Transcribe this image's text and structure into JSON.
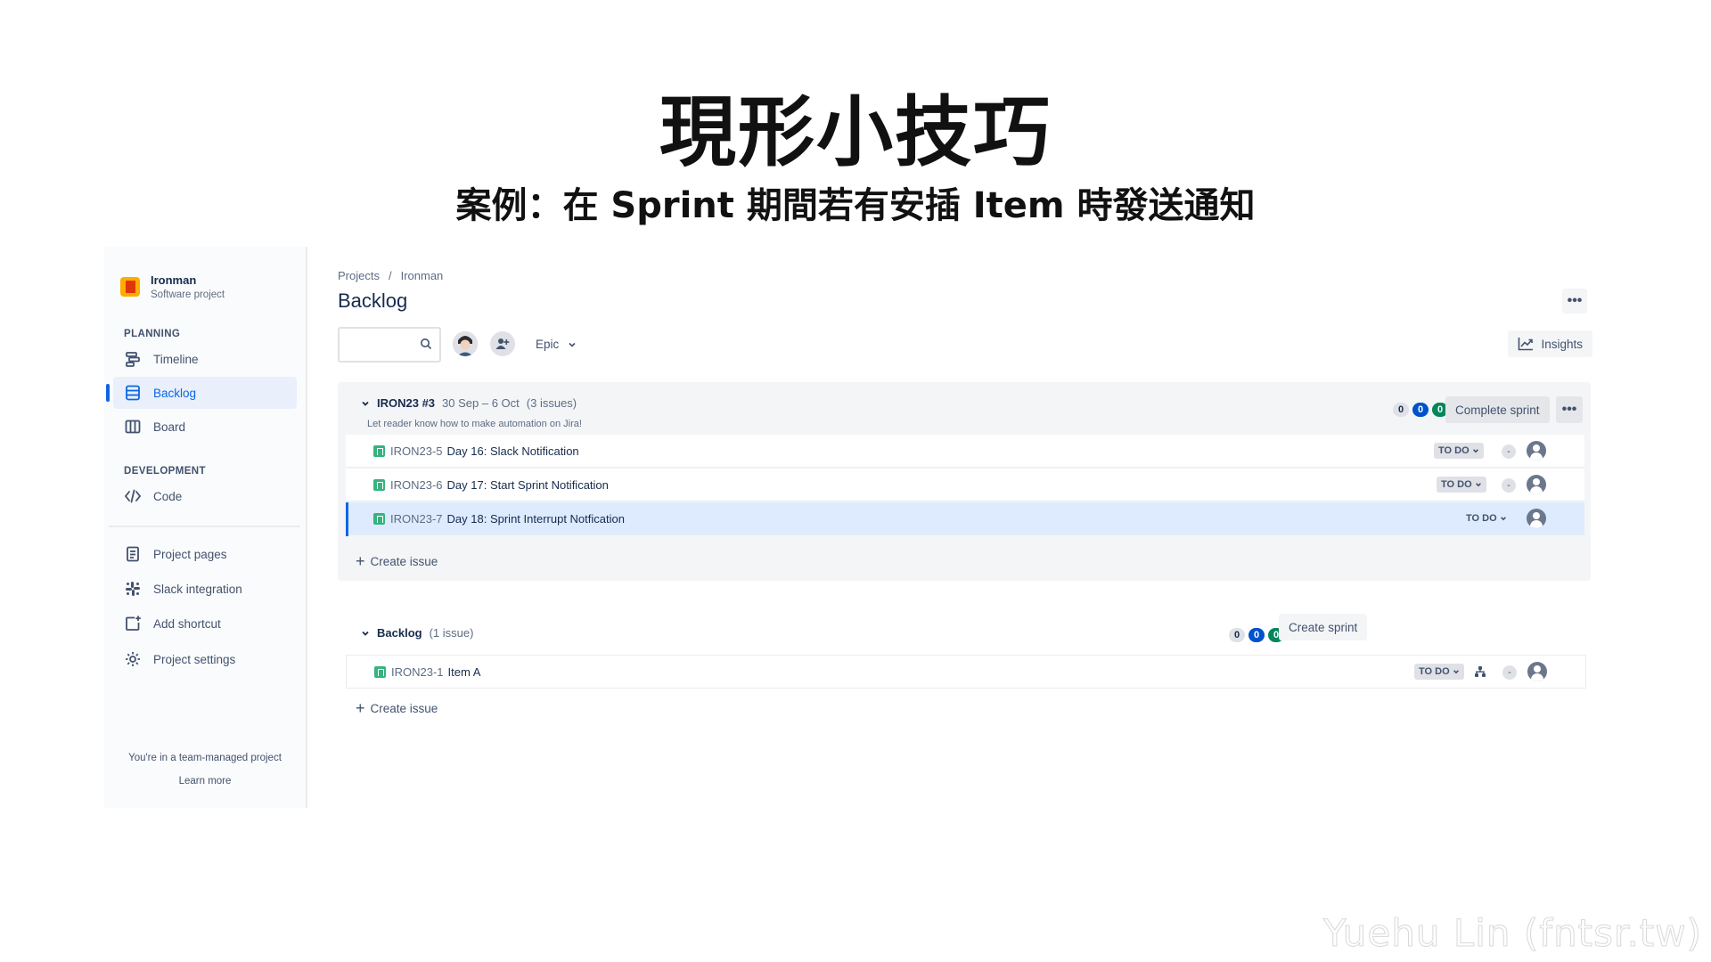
{
  "slide": {
    "title": "現形小技巧",
    "subtitle": "案例：在 Sprint 期間若有安插 Item 時發送通知",
    "watermark": "Yuehu Lin (fntsr.tw)"
  },
  "sidebar": {
    "project_name": "Ironman",
    "project_type": "Software project",
    "planning_label": "PLANNING",
    "development_label": "DEVELOPMENT",
    "items": [
      {
        "label": "Timeline",
        "icon": "timeline-icon"
      },
      {
        "label": "Backlog",
        "icon": "backlog-icon",
        "active": true
      },
      {
        "label": "Board",
        "icon": "board-icon"
      },
      {
        "label": "Code",
        "icon": "code-icon"
      },
      {
        "label": "Project pages",
        "icon": "pages-icon"
      },
      {
        "label": "Slack integration",
        "icon": "slack-icon"
      },
      {
        "label": "Add shortcut",
        "icon": "add-shortcut-icon"
      },
      {
        "label": "Project settings",
        "icon": "settings-icon"
      }
    ],
    "footer_text": "You're in a team-managed project",
    "footer_link": "Learn more"
  },
  "header": {
    "breadcrumb": [
      "Projects",
      "Ironman"
    ],
    "breadcrumb_sep": "/",
    "title": "Backlog",
    "more": "•••"
  },
  "toolbar": {
    "search_placeholder": "",
    "epic_label": "Epic",
    "insights_label": "Insights"
  },
  "sprint": {
    "name": "IRON23 #3",
    "dates": "30 Sep – 6 Oct",
    "issue_count": "(3 issues)",
    "goal": "Let reader know how to make automation on Jira!",
    "counts": [
      "0",
      "0",
      "0"
    ],
    "complete_label": "Complete sprint",
    "more": "•••",
    "issues": [
      {
        "key": "IRON23-5",
        "summary": "Day 16: Slack Notification",
        "status": "TO DO",
        "estimate": "-"
      },
      {
        "key": "IRON23-6",
        "summary": "Day 17: Start Sprint Notification",
        "status": "TO DO",
        "estimate": "-"
      },
      {
        "key": "IRON23-7",
        "summary": "Day 18: Sprint Interrupt Notfication",
        "status": "TO DO",
        "estimate": ""
      }
    ],
    "create_label": "Create issue"
  },
  "backlog": {
    "name": "Backlog",
    "issue_count": "(1 issue)",
    "counts": [
      "0",
      "0",
      "0"
    ],
    "create_sprint_label": "Create sprint",
    "issues": [
      {
        "key": "IRON23-1",
        "summary": "Item A",
        "status": "TO DO",
        "estimate": "-"
      }
    ],
    "create_label": "Create issue"
  },
  "colors": {
    "accent": "#0c66e4",
    "story": "#36b37e",
    "count_blue": "#0052cc",
    "count_green": "#00875a"
  }
}
